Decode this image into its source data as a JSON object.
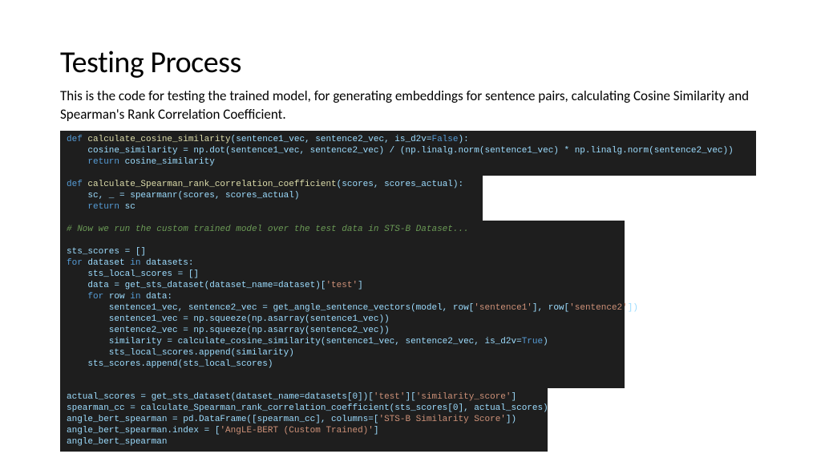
{
  "title": "Testing Process",
  "subtitle": "This is the code for testing the trained model, for generating embeddings for sentence pairs, calculating Cosine Similarity and Spearman's Rank Correlation Coefficient.",
  "code": {
    "block1": {
      "l1_def": "def ",
      "l1_fn": "calculate_cosine_similarity",
      "l1_sig_a": "(sentence1_vec, sentence2_vec, is_d2v=",
      "l1_false": "False",
      "l1_sig_b": "):",
      "l2": "    cosine_similarity = np.dot(sentence1_vec, sentence2_vec) / (np.linalg.norm(sentence1_vec) * np.linalg.norm(sentence2_vec))",
      "l3_ret": "    return ",
      "l3_var": "cosine_similarity"
    },
    "block2": {
      "l1_def": "def ",
      "l1_fn": "calculate_Spearman_rank_correlation_coefficient",
      "l1_sig": "(scores, scores_actual):",
      "l2": "    sc, _ = spearmanr(scores, scores_actual)",
      "l3_ret": "    return ",
      "l3_var": "sc"
    },
    "block3": {
      "l1_cmt": "# Now we run the custom trained model over the test data in STS-B Dataset...",
      "l2_blank": " ",
      "l3": "sts_scores = []",
      "l4_for": "for ",
      "l4_a": "dataset ",
      "l4_in": "in ",
      "l4_b": "datasets:",
      "l5": "    sts_local_scores = []",
      "l6_a": "    data = get_sts_dataset(dataset_name=dataset)[",
      "l6_s": "'test'",
      "l6_b": "]",
      "l7_for": "    for ",
      "l7_a": "row ",
      "l7_in": "in ",
      "l7_b": "data:",
      "l8_a": "        sentence1_vec, sentence2_vec = get_angle_sentence_vectors(model, row[",
      "l8_s1": "'sentence1'",
      "l8_b": "], row[",
      "l8_s2": "'sentence2'",
      "l8_c": "])",
      "l9": "        sentence1_vec = np.squeeze(np.asarray(sentence1_vec))",
      "l10": "        sentence2_vec = np.squeeze(np.asarray(sentence2_vec))",
      "l11_a": "        similarity = calculate_cosine_similarity(sentence1_vec, sentence2_vec, is_d2v=",
      "l11_true": "True",
      "l11_b": ")",
      "l12": "        sts_local_scores.append(similarity)",
      "l13": "    sts_scores.append(sts_local_scores)"
    },
    "block4": {
      "l1_a": "actual_scores = get_sts_dataset(dataset_name=datasets[0])[",
      "l1_s1": "'test'",
      "l1_b": "][",
      "l1_s2": "'similarity_score'",
      "l1_c": "]",
      "l2": "spearman_cc = calculate_Spearman_rank_correlation_coefficient(sts_scores[0], actual_scores)",
      "l3_a": "angle_bert_spearman = pd.DataFrame([spearman_cc], columns=[",
      "l3_s": "'STS-B Similarity Score'",
      "l3_b": "])",
      "l4_a": "angle_bert_spearman.index = [",
      "l4_s": "'AngLE-BERT (Custom Trained)'",
      "l4_b": "]",
      "l5": "angle_bert_spearman"
    }
  }
}
